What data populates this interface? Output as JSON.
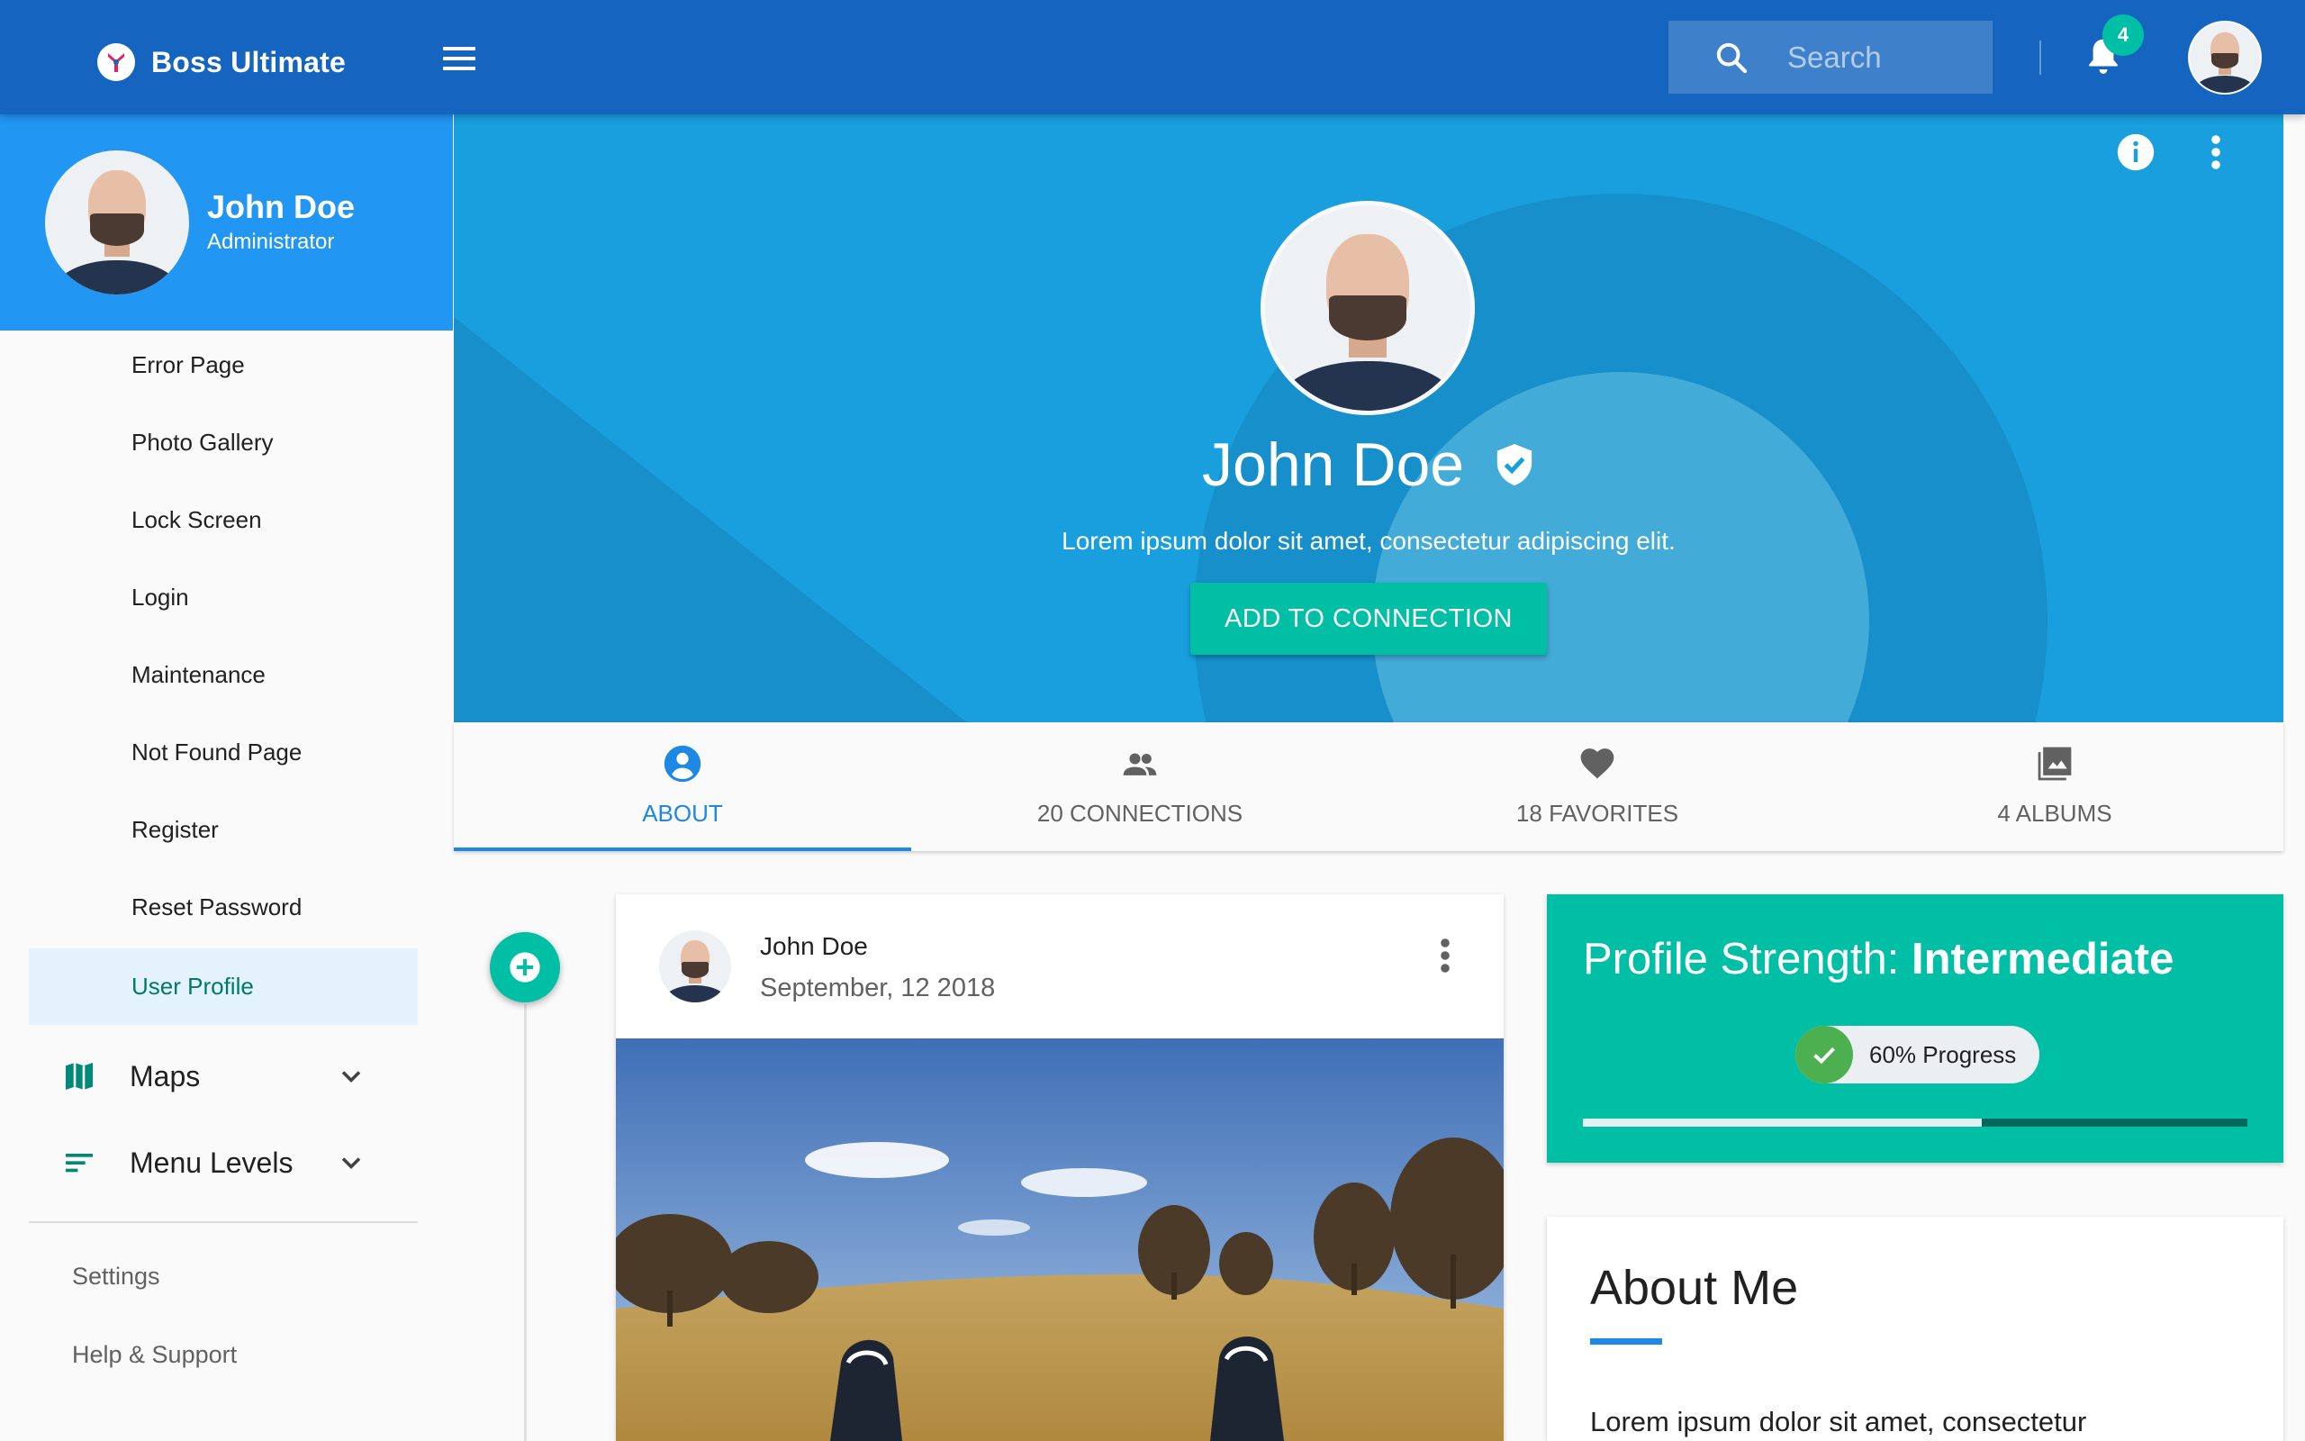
{
  "app": {
    "title": "Boss Ultimate"
  },
  "header": {
    "search_placeholder": "Search",
    "notification_count": "4"
  },
  "user": {
    "name": "John Doe",
    "role": "Administrator"
  },
  "sidebar": {
    "items": [
      {
        "label": "Error Page",
        "active": false
      },
      {
        "label": "Photo Gallery",
        "active": false
      },
      {
        "label": "Lock Screen",
        "active": false
      },
      {
        "label": "Login",
        "active": false
      },
      {
        "label": "Maintenance",
        "active": false
      },
      {
        "label": "Not Found Page",
        "active": false
      },
      {
        "label": "Register",
        "active": false
      },
      {
        "label": "Reset Password",
        "active": false
      },
      {
        "label": "User Profile",
        "active": true
      }
    ],
    "groups": [
      {
        "label": "Maps",
        "icon": "map-icon"
      },
      {
        "label": "Menu Levels",
        "icon": "sort-lines-icon"
      }
    ],
    "footer": [
      {
        "label": "Settings"
      },
      {
        "label": "Help & Support"
      }
    ]
  },
  "profile": {
    "name": "John Doe",
    "bio": "Lorem ipsum dolor sit amet, consectetur adipiscing elit.",
    "cta": "ADD TO CONNECTION"
  },
  "tabs": [
    {
      "label": "ABOUT",
      "icon": "account-circle-icon",
      "active": true
    },
    {
      "label": "20 CONNECTIONS",
      "icon": "people-icon",
      "active": false
    },
    {
      "label": "18 FAVORITES",
      "icon": "heart-icon",
      "active": false
    },
    {
      "label": "4 ALBUMS",
      "icon": "photo-album-icon",
      "active": false
    }
  ],
  "post": {
    "author": "John Doe",
    "date": "September, 12 2018"
  },
  "strength": {
    "title_prefix": "Profile Strength: ",
    "level": "Intermediate",
    "progress_label": "60% Progress",
    "progress": 0.6
  },
  "about": {
    "title": "About Me",
    "text": "Lorem ipsum dolor sit amet, consectetur"
  },
  "colors": {
    "topbar": "#1565c0",
    "hero": "#1a9fde",
    "accent": "#00bfa5",
    "tab_active": "#1e88e5"
  }
}
